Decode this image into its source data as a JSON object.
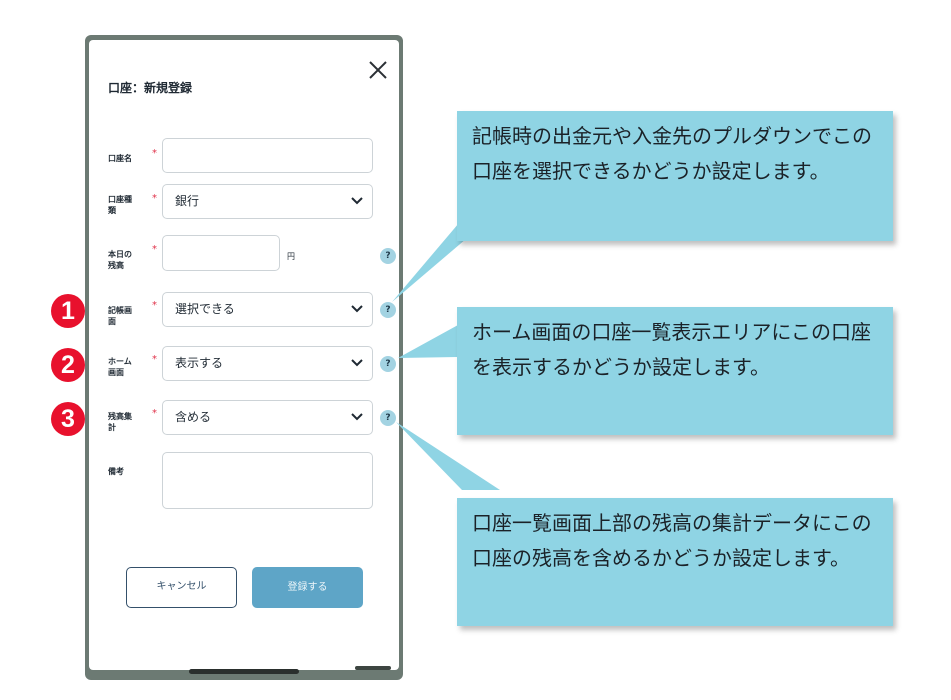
{
  "dialog": {
    "title": "口座：新規登録",
    "close_icon": "close-icon"
  },
  "form": {
    "name": {
      "label": "口座名",
      "required": "*",
      "value": ""
    },
    "type": {
      "label": "口座種\n類",
      "required": "*",
      "value": "銀行"
    },
    "balance": {
      "label": "本日の\n残高",
      "required": "*",
      "value": "",
      "unit": "円"
    },
    "ledger_screen": {
      "label": "記帳画\n面",
      "required": "*",
      "value": "選択できる"
    },
    "home_screen": {
      "label": "ホーム\n画面",
      "required": "*",
      "value": "表示する"
    },
    "balance_total": {
      "label": "残高集\n計",
      "required": "*",
      "value": "含める"
    },
    "memo": {
      "label": "備考",
      "value": ""
    },
    "help_glyph": "?"
  },
  "markers": [
    "1",
    "2",
    "3"
  ],
  "buttons": {
    "cancel": "キャンセル",
    "submit": "登録する"
  },
  "callouts": [
    "記帳時の出金元や入金先のプルダウンでこの口座を選択できるかどうか設定します。",
    "ホーム画面の口座一覧表示エリアにこの口座を表示するかどうか設定します。",
    "口座一覧画面上部の残高の集計データにこの口座の残高を含めるかどうか設定します。"
  ],
  "colors": {
    "callout_bg": "#8fd4e4",
    "marker_red": "#e8112d",
    "submit_blue": "#5ea5c7",
    "required_red": "#e0324a"
  }
}
